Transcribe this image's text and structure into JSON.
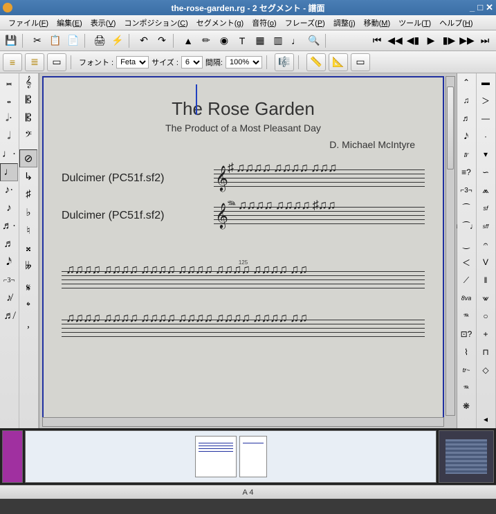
{
  "window": {
    "title": "the-rose-garden.rg - 2 セグメント - 譜面"
  },
  "menu": {
    "file": {
      "t": "ファイル",
      "u": "F"
    },
    "edit": {
      "t": "編集",
      "u": "E"
    },
    "view": {
      "t": "表示",
      "u": "V"
    },
    "composition": {
      "t": "コンポジション",
      "u": "C"
    },
    "segment": {
      "t": "セグメント",
      "u": "g"
    },
    "notes": {
      "t": "音符",
      "u": "o"
    },
    "phrase": {
      "t": "フレーズ",
      "u": "P"
    },
    "adjust": {
      "t": "調整",
      "u": "j"
    },
    "move": {
      "t": "移動",
      "u": "M"
    },
    "tools": {
      "t": "ツール",
      "u": "T"
    },
    "help": {
      "t": "ヘルプ",
      "u": "H"
    }
  },
  "toolbar2": {
    "font_label": "フォント :",
    "font_value": "Feta",
    "size_label": "サイズ :",
    "size_value": "6",
    "spacing_label": "間隔:",
    "spacing_value": "100%"
  },
  "score": {
    "title": "The Rose Garden",
    "subtitle": "The Product of a Most Pleasant Day",
    "author": "D. Michael McIntyre",
    "inst1": "Dulcimer (PC51f.sf2)",
    "inst2": "Dulcimer (PC51f.sf2)",
    "measure_no": "125"
  },
  "status": {
    "text": "A 4"
  }
}
